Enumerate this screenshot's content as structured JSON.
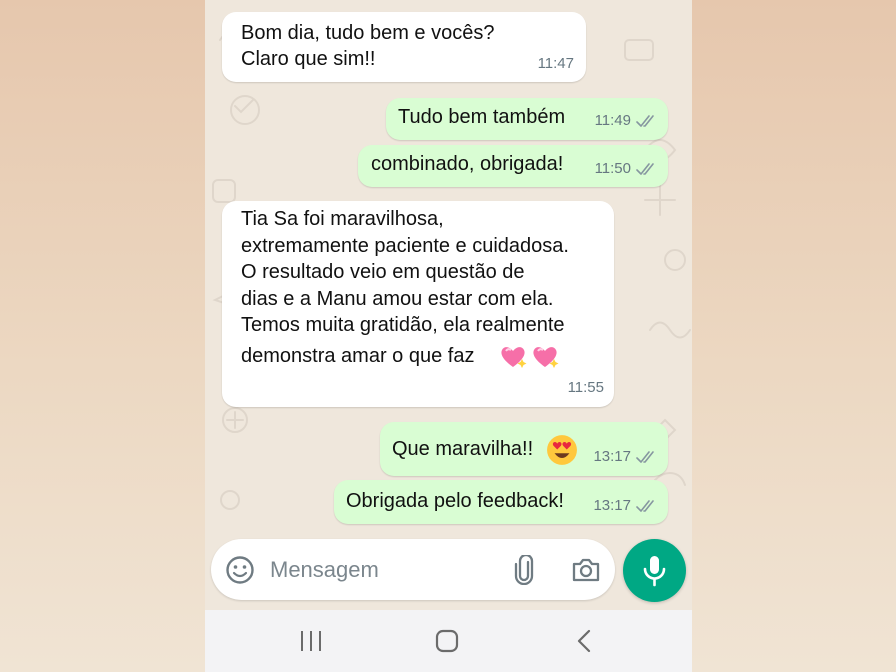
{
  "colors": {
    "incoming_bubble": "#ffffff",
    "outgoing_bubble": "#d9fdd3",
    "accent_green": "#00a884",
    "timestamp": "#667781",
    "read_ticks": "#8696a0"
  },
  "messages": [
    {
      "direction": "incoming",
      "lines": [
        "Bom dia, tudo bem e vocês?",
        "Claro que sim!!"
      ],
      "time": "11:47"
    },
    {
      "direction": "outgoing",
      "text": "Tudo bem também",
      "time": "11:49",
      "status": "read-double-check"
    },
    {
      "direction": "outgoing",
      "text": "combinado, obrigada!",
      "time": "11:50",
      "status": "read-double-check"
    },
    {
      "direction": "incoming",
      "lines": [
        "Tia Sa foi maravilhosa,",
        "extremamente paciente e cuidadosa.",
        "O resultado veio em questão de",
        "dias e a Manu amou estar com ela.",
        "Temos muita gratidão, ela realmente",
        "demonstra amar o que faz"
      ],
      "emoji": [
        "sparkling-heart",
        "sparkling-heart"
      ],
      "time": "11:55"
    },
    {
      "direction": "outgoing",
      "text": "Que maravilha!!",
      "emoji": [
        "heart-eyes"
      ],
      "time": "13:17",
      "status": "read-double-check"
    },
    {
      "direction": "outgoing",
      "text": "Obrigada pelo feedback!",
      "time": "13:17",
      "status": "read-double-check"
    }
  ],
  "composer": {
    "placeholder": "Mensagem",
    "icons": [
      "emoji-icon",
      "attach-icon",
      "camera-icon"
    ],
    "send_icon": "mic-icon"
  },
  "navbar": {
    "icons": [
      "recent-apps-icon",
      "home-icon",
      "back-icon"
    ]
  }
}
